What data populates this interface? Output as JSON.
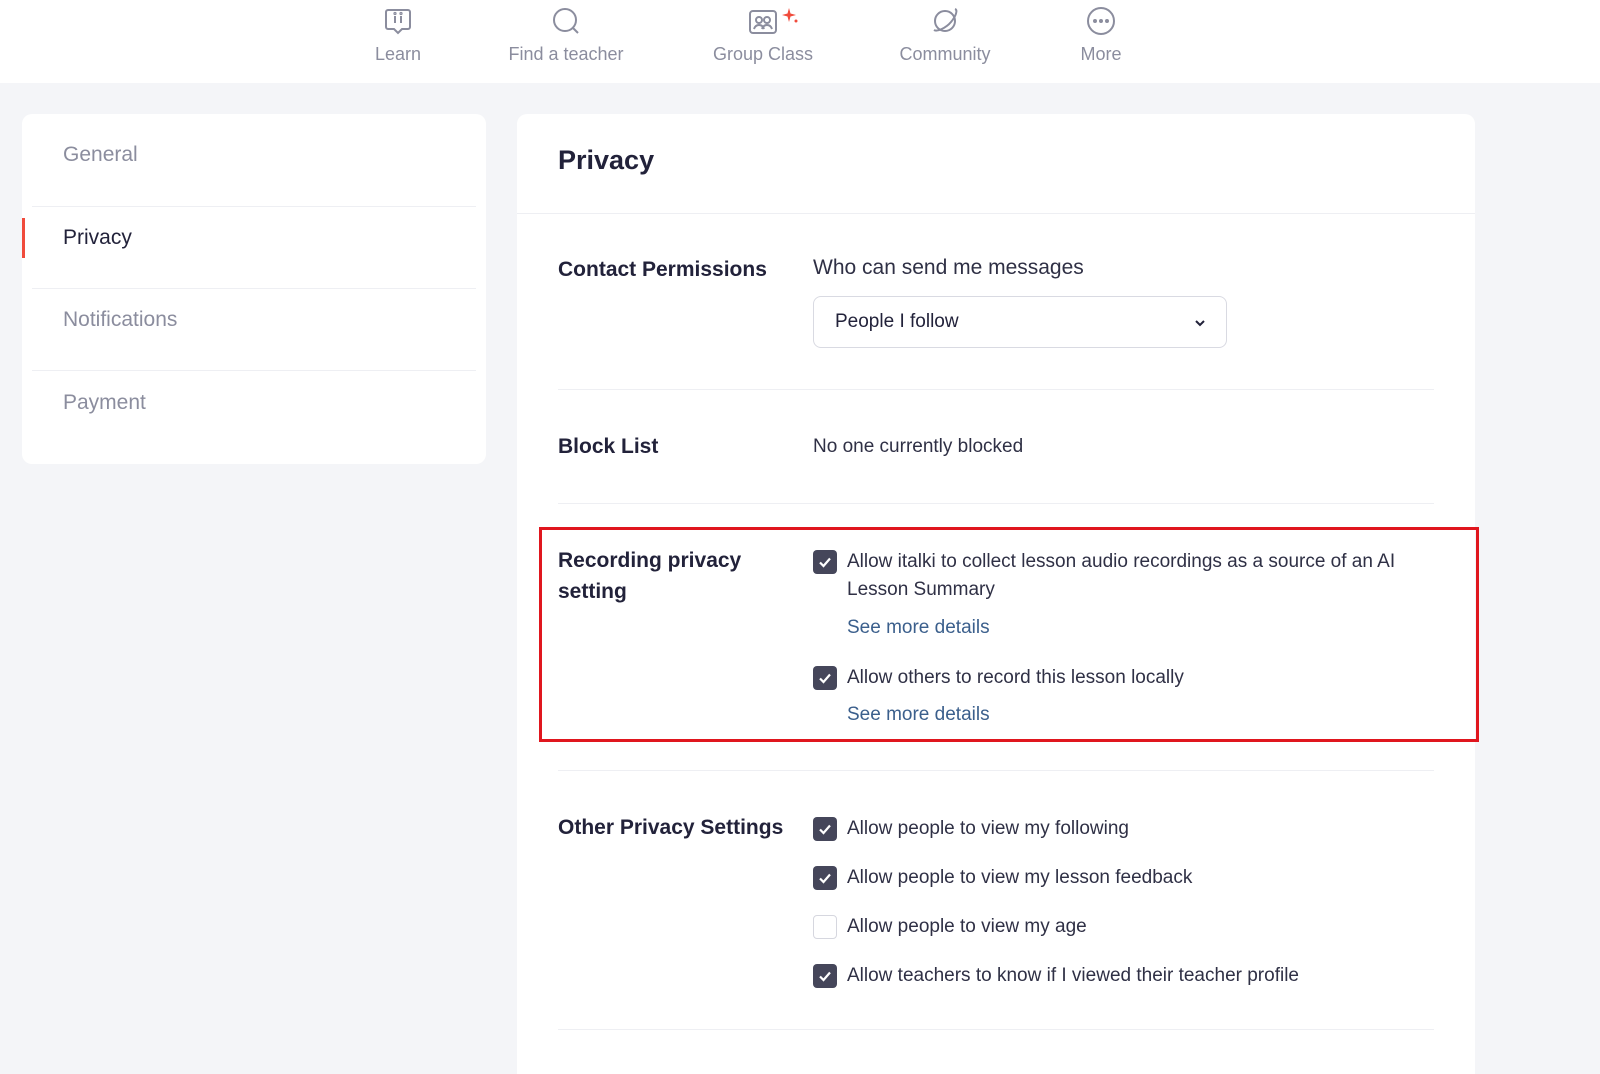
{
  "nav": {
    "items": [
      {
        "label": "Learn",
        "icon": "learn-icon"
      },
      {
        "label": "Find a teacher",
        "icon": "search-icon"
      },
      {
        "label": "Group Class",
        "icon": "group-class-icon"
      },
      {
        "label": "Community",
        "icon": "planet-icon"
      },
      {
        "label": "More",
        "icon": "more-icon"
      }
    ],
    "accent_color": "#f04b3c"
  },
  "sidebar": {
    "items": [
      {
        "label": "General",
        "active": false
      },
      {
        "label": "Privacy",
        "active": true
      },
      {
        "label": "Notifications",
        "active": false
      },
      {
        "label": "Payment",
        "active": false
      }
    ]
  },
  "main": {
    "title": "Privacy",
    "contact": {
      "label": "Contact Permissions",
      "field_label": "Who can send me messages",
      "selected": "People I follow"
    },
    "block": {
      "label": "Block List",
      "value": "No one currently blocked"
    },
    "recording": {
      "label": "Recording privacy setting",
      "options": [
        {
          "text": "Allow italki to collect lesson audio recordings as a source of an AI Lesson Summary",
          "checked": true,
          "link": "See more details"
        },
        {
          "text": "Allow others to record this lesson locally",
          "checked": true,
          "link": "See more details"
        }
      ]
    },
    "other": {
      "label": "Other Privacy Settings",
      "options": [
        {
          "text": "Allow people to view my following",
          "checked": true
        },
        {
          "text": "Allow people to view my lesson feedback",
          "checked": true
        },
        {
          "text": "Allow people to view my age",
          "checked": false
        },
        {
          "text": "Allow teachers to know if I viewed their teacher profile",
          "checked": true
        }
      ]
    }
  },
  "colors": {
    "checkbox_checked": "#45465a",
    "link": "#3b5f8c",
    "highlight": "#e0161e"
  }
}
